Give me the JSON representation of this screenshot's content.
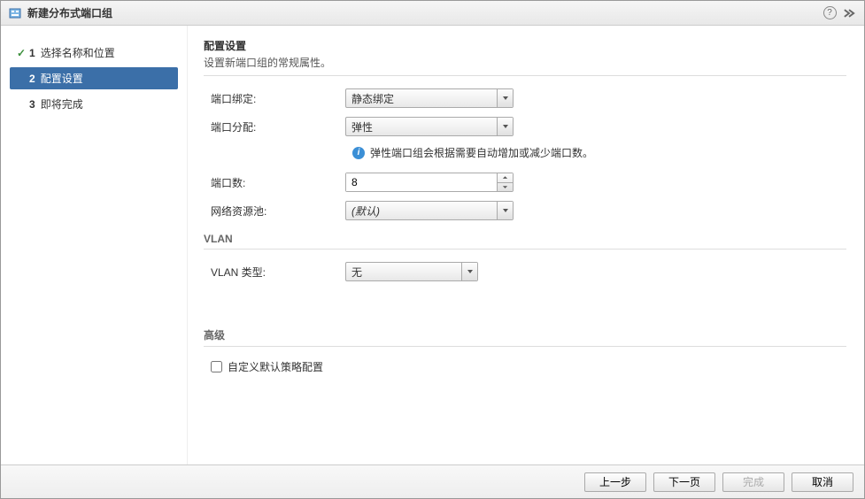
{
  "title": "新建分布式端口组",
  "steps": [
    {
      "num": "1",
      "label": "选择名称和位置",
      "state": "completed"
    },
    {
      "num": "2",
      "label": "配置设置",
      "state": "active"
    },
    {
      "num": "3",
      "label": "即将完成",
      "state": "pending"
    }
  ],
  "section": {
    "title": "配置设置",
    "desc": "设置新端口组的常规属性。"
  },
  "form": {
    "port_binding_label": "端口绑定:",
    "port_binding_value": "静态绑定",
    "port_alloc_label": "端口分配:",
    "port_alloc_value": "弹性",
    "port_alloc_info": "弹性端口组会根据需要自动增加或减少端口数。",
    "port_count_label": "端口数:",
    "port_count_value": "8",
    "net_pool_label": "网络资源池:",
    "net_pool_value": "(默认)"
  },
  "vlan": {
    "header": "VLAN",
    "type_label": "VLAN 类型:",
    "type_value": "无"
  },
  "advanced": {
    "header": "高级",
    "checkbox_label": "自定义默认策略配置"
  },
  "footer": {
    "back": "上一步",
    "next": "下一页",
    "finish": "完成",
    "cancel": "取消"
  }
}
